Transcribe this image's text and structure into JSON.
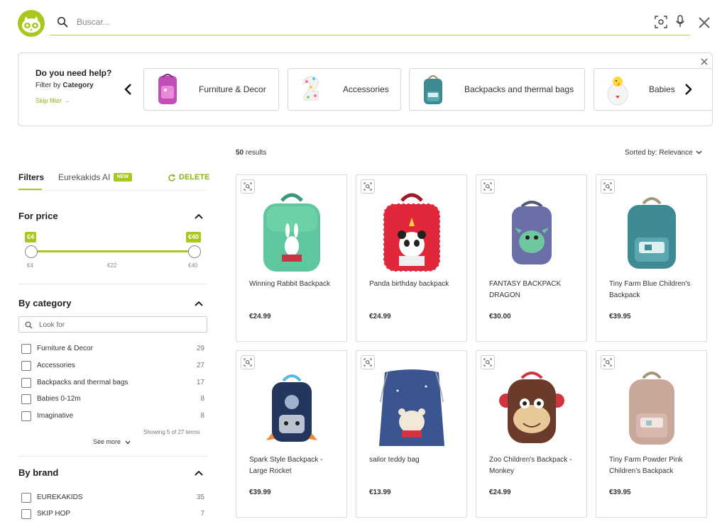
{
  "header": {
    "search_placeholder": "Buscar...",
    "icons": [
      "logo-icon",
      "search-icon",
      "visual-search-icon",
      "mic-icon",
      "close-icon"
    ],
    "accent_color": "#a8c81d"
  },
  "category_banner": {
    "title": "Do you need help?",
    "subtitle_prefix": "Filter by",
    "subtitle_bold": "Category",
    "skip": "Skip filter →",
    "categories": [
      {
        "label": "Furniture & Decor"
      },
      {
        "label": "Accessories"
      },
      {
        "label": "Backpacks and thermal bags"
      },
      {
        "label": "Babies"
      }
    ]
  },
  "sidebar": {
    "tabs": {
      "filters": "Filters",
      "ai": "Eurekakids AI",
      "new_badge": "NEW",
      "delete": "DELETE"
    },
    "price": {
      "title": "For price",
      "min_tag": "€4",
      "max_tag": "€40",
      "ticks": [
        "€4",
        "€22",
        "€40"
      ]
    },
    "category": {
      "title": "By category",
      "search_placeholder": "Look for",
      "items": [
        {
          "label": "Furniture & Decor",
          "count": "29"
        },
        {
          "label": "Accessories",
          "count": "27"
        },
        {
          "label": "Backpacks and thermal bags",
          "count": "17"
        },
        {
          "label": "Babies 0-12m",
          "count": "8"
        },
        {
          "label": "Imaginative",
          "count": "8"
        }
      ],
      "showing": "Showing 5 of 27 terms",
      "see_more": "See more"
    },
    "brand": {
      "title": "By brand",
      "items": [
        {
          "label": "EUREKAKIDS",
          "count": "35"
        },
        {
          "label": "SKIP HOP",
          "count": "7"
        }
      ]
    }
  },
  "results": {
    "count_number": "50",
    "count_label": "results",
    "sort_label": "Sorted by:",
    "sort_value": "Relevance",
    "products": [
      {
        "name": "Winning Rabbit Backpack",
        "price": "€24.99"
      },
      {
        "name": "Panda birthday backpack",
        "price": "€24.99"
      },
      {
        "name": "FANTASY BACKPACK DRAGON",
        "price": "€30.00"
      },
      {
        "name": "Tiny Farm Blue Children's Backpack",
        "price": "€39.95"
      },
      {
        "name": "Spark Style Backpack - Large Rocket",
        "price": "€39.99"
      },
      {
        "name": "sailor teddy bag",
        "price": "€13.99"
      },
      {
        "name": "Zoo Children's Backpack - Monkey",
        "price": "€24.99"
      },
      {
        "name": "Tiny Farm Powder Pink Children's Backpack",
        "price": "€39.95"
      }
    ]
  }
}
